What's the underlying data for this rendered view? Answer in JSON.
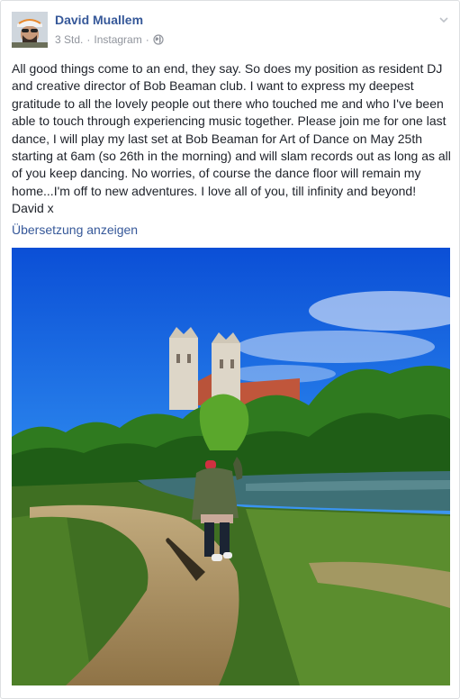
{
  "post": {
    "author": "David Muallem",
    "time": "3 Std.",
    "separator": "·",
    "source": "Instagram",
    "text": "All good things come to an end, they say. So does my position as resident DJ and creative director of Bob Beaman club. I want to express my deepest gratitude to all the lovely people out there who touched me and who I've been able to touch through experiencing music together. Please join me for one last dance, I will play my last set at Bob Beaman for Art of Dance on May 25th starting at 6am (so 26th in the morning) and will slam records out as long as all of you keep dancing. No worries, of course the dance floor will remain my home...I'm off to new adventures. I love all of you, till infinity and beyond!\nDavid x",
    "translate_link": "Übersetzung anzeigen",
    "audience_icon": "globe-icon",
    "options_icon": "chevron-down-icon"
  },
  "colors": {
    "link": "#365899",
    "meta": "#90949c",
    "text": "#1d2129",
    "border": "#dddfe2"
  }
}
